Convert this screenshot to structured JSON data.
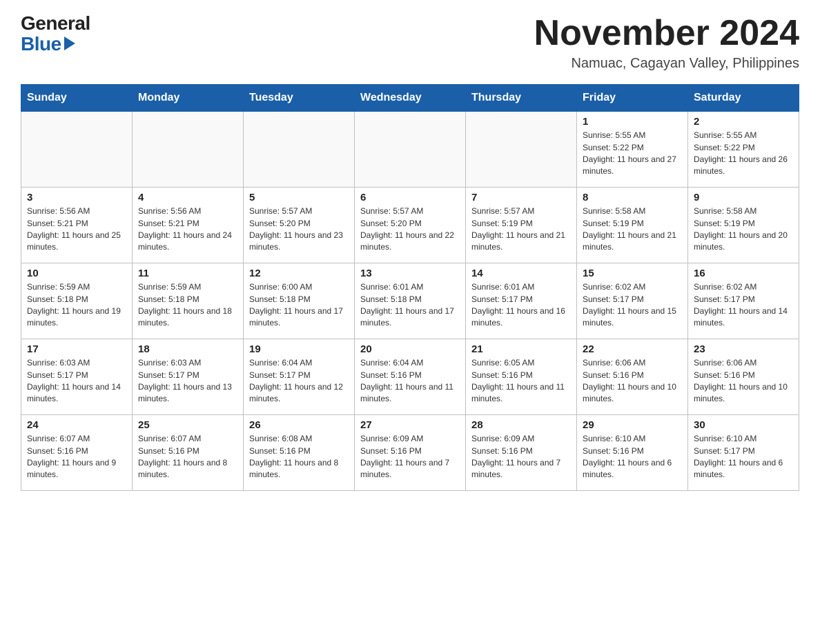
{
  "header": {
    "logo_general": "General",
    "logo_blue": "Blue",
    "month_title": "November 2024",
    "location": "Namuac, Cagayan Valley, Philippines"
  },
  "days_of_week": [
    "Sunday",
    "Monday",
    "Tuesday",
    "Wednesday",
    "Thursday",
    "Friday",
    "Saturday"
  ],
  "weeks": [
    [
      {
        "day": "",
        "info": ""
      },
      {
        "day": "",
        "info": ""
      },
      {
        "day": "",
        "info": ""
      },
      {
        "day": "",
        "info": ""
      },
      {
        "day": "",
        "info": ""
      },
      {
        "day": "1",
        "info": "Sunrise: 5:55 AM\nSunset: 5:22 PM\nDaylight: 11 hours and 27 minutes."
      },
      {
        "day": "2",
        "info": "Sunrise: 5:55 AM\nSunset: 5:22 PM\nDaylight: 11 hours and 26 minutes."
      }
    ],
    [
      {
        "day": "3",
        "info": "Sunrise: 5:56 AM\nSunset: 5:21 PM\nDaylight: 11 hours and 25 minutes."
      },
      {
        "day": "4",
        "info": "Sunrise: 5:56 AM\nSunset: 5:21 PM\nDaylight: 11 hours and 24 minutes."
      },
      {
        "day": "5",
        "info": "Sunrise: 5:57 AM\nSunset: 5:20 PM\nDaylight: 11 hours and 23 minutes."
      },
      {
        "day": "6",
        "info": "Sunrise: 5:57 AM\nSunset: 5:20 PM\nDaylight: 11 hours and 22 minutes."
      },
      {
        "day": "7",
        "info": "Sunrise: 5:57 AM\nSunset: 5:19 PM\nDaylight: 11 hours and 21 minutes."
      },
      {
        "day": "8",
        "info": "Sunrise: 5:58 AM\nSunset: 5:19 PM\nDaylight: 11 hours and 21 minutes."
      },
      {
        "day": "9",
        "info": "Sunrise: 5:58 AM\nSunset: 5:19 PM\nDaylight: 11 hours and 20 minutes."
      }
    ],
    [
      {
        "day": "10",
        "info": "Sunrise: 5:59 AM\nSunset: 5:18 PM\nDaylight: 11 hours and 19 minutes."
      },
      {
        "day": "11",
        "info": "Sunrise: 5:59 AM\nSunset: 5:18 PM\nDaylight: 11 hours and 18 minutes."
      },
      {
        "day": "12",
        "info": "Sunrise: 6:00 AM\nSunset: 5:18 PM\nDaylight: 11 hours and 17 minutes."
      },
      {
        "day": "13",
        "info": "Sunrise: 6:01 AM\nSunset: 5:18 PM\nDaylight: 11 hours and 17 minutes."
      },
      {
        "day": "14",
        "info": "Sunrise: 6:01 AM\nSunset: 5:17 PM\nDaylight: 11 hours and 16 minutes."
      },
      {
        "day": "15",
        "info": "Sunrise: 6:02 AM\nSunset: 5:17 PM\nDaylight: 11 hours and 15 minutes."
      },
      {
        "day": "16",
        "info": "Sunrise: 6:02 AM\nSunset: 5:17 PM\nDaylight: 11 hours and 14 minutes."
      }
    ],
    [
      {
        "day": "17",
        "info": "Sunrise: 6:03 AM\nSunset: 5:17 PM\nDaylight: 11 hours and 14 minutes."
      },
      {
        "day": "18",
        "info": "Sunrise: 6:03 AM\nSunset: 5:17 PM\nDaylight: 11 hours and 13 minutes."
      },
      {
        "day": "19",
        "info": "Sunrise: 6:04 AM\nSunset: 5:17 PM\nDaylight: 11 hours and 12 minutes."
      },
      {
        "day": "20",
        "info": "Sunrise: 6:04 AM\nSunset: 5:16 PM\nDaylight: 11 hours and 11 minutes."
      },
      {
        "day": "21",
        "info": "Sunrise: 6:05 AM\nSunset: 5:16 PM\nDaylight: 11 hours and 11 minutes."
      },
      {
        "day": "22",
        "info": "Sunrise: 6:06 AM\nSunset: 5:16 PM\nDaylight: 11 hours and 10 minutes."
      },
      {
        "day": "23",
        "info": "Sunrise: 6:06 AM\nSunset: 5:16 PM\nDaylight: 11 hours and 10 minutes."
      }
    ],
    [
      {
        "day": "24",
        "info": "Sunrise: 6:07 AM\nSunset: 5:16 PM\nDaylight: 11 hours and 9 minutes."
      },
      {
        "day": "25",
        "info": "Sunrise: 6:07 AM\nSunset: 5:16 PM\nDaylight: 11 hours and 8 minutes."
      },
      {
        "day": "26",
        "info": "Sunrise: 6:08 AM\nSunset: 5:16 PM\nDaylight: 11 hours and 8 minutes."
      },
      {
        "day": "27",
        "info": "Sunrise: 6:09 AM\nSunset: 5:16 PM\nDaylight: 11 hours and 7 minutes."
      },
      {
        "day": "28",
        "info": "Sunrise: 6:09 AM\nSunset: 5:16 PM\nDaylight: 11 hours and 7 minutes."
      },
      {
        "day": "29",
        "info": "Sunrise: 6:10 AM\nSunset: 5:16 PM\nDaylight: 11 hours and 6 minutes."
      },
      {
        "day": "30",
        "info": "Sunrise: 6:10 AM\nSunset: 5:17 PM\nDaylight: 11 hours and 6 minutes."
      }
    ]
  ]
}
